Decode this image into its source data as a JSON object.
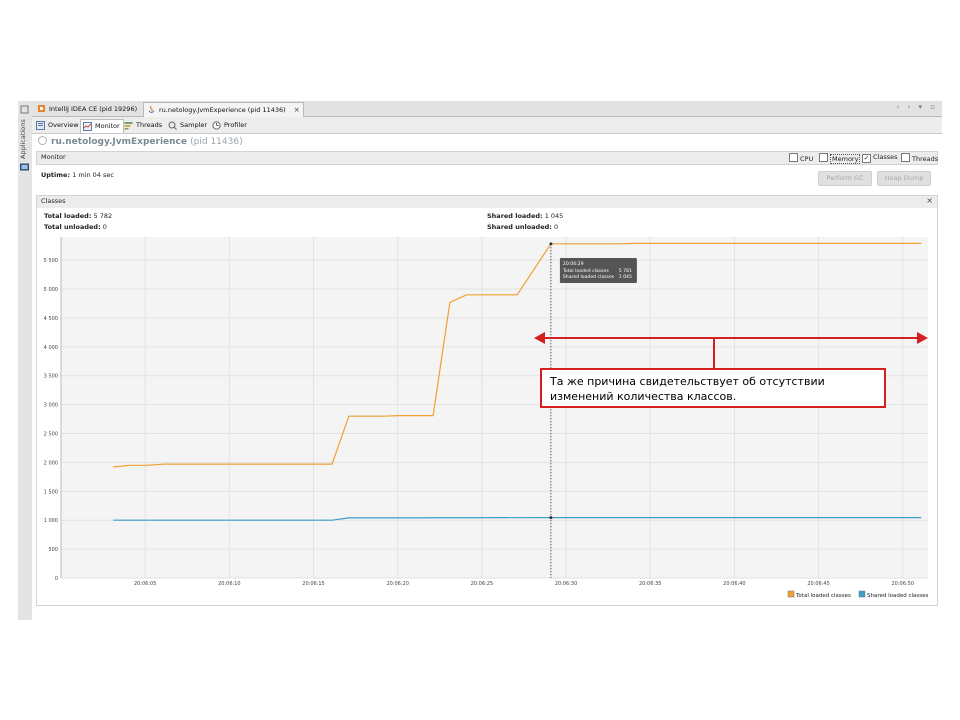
{
  "left_strip": {
    "label": "Applications",
    "icons": [
      "pin-icon",
      "monitor-icon"
    ]
  },
  "tabs": [
    {
      "label": "IntelliJ IDEA CE (pid 19296)",
      "icon": "intellij-app-icon",
      "active": false
    },
    {
      "label": "ru.netology.JvmExperience (pid 11436)",
      "icon": "java-app-icon",
      "active": true
    }
  ],
  "tab_close_glyph": "×",
  "window_controls": "‹ › ▾ ▫",
  "subtabs": [
    {
      "label": "Overview",
      "icon": "overview-icon"
    },
    {
      "label": "Monitor",
      "icon": "monitor-icon",
      "active": true
    },
    {
      "label": "Threads",
      "icon": "threads-icon"
    },
    {
      "label": "Sampler",
      "icon": "sampler-icon"
    },
    {
      "label": "Profiler",
      "icon": "profiler-icon"
    }
  ],
  "app_title": {
    "name": "ru.netology.JvmExperience",
    "pid": "(pid 11436)"
  },
  "monitor": {
    "title": "Monitor",
    "checkboxes": [
      {
        "label": "CPU",
        "checked": false
      },
      {
        "label": "Memory",
        "checked": false
      },
      {
        "label": "Classes",
        "checked": true
      },
      {
        "label": "Threads",
        "checked": false
      }
    ],
    "uptime_label": "Uptime:",
    "uptime_value": "1 min 04 sec",
    "perform_gc": "Perform GC",
    "heap_dump": "Heap Dump"
  },
  "classes_panel": {
    "title": "Classes",
    "close_glyph": "×",
    "total_loaded_label": "Total loaded:",
    "total_loaded_value": "5 782",
    "total_unloaded_label": "Total unloaded:",
    "total_unloaded_value": "0",
    "shared_loaded_label": "Shared loaded:",
    "shared_loaded_value": "1 045",
    "shared_unloaded_label": "Shared unloaded:",
    "shared_unloaded_value": "0"
  },
  "chart_data": {
    "type": "line",
    "y_ticks": [
      "0",
      "500",
      "1 000",
      "1 500",
      "2 000",
      "2 500",
      "3 000",
      "3 500",
      "4 000",
      "4 500",
      "5 000",
      "5 500"
    ],
    "x_ticks": [
      "20:06:05",
      "20:06:10",
      "20:06:15",
      "20:06:20",
      "20:06:25",
      "20:06:30",
      "20:06:35",
      "20:06:40",
      "20:06:45",
      "20:06:50"
    ],
    "ylim": [
      0,
      5900
    ],
    "series": [
      {
        "name": "Total loaded classes",
        "color": "#f0a030",
        "points": [
          [
            3.1,
            1920
          ],
          [
            4.1,
            1950
          ],
          [
            5.1,
            1950
          ],
          [
            6.1,
            1970
          ],
          [
            10.1,
            1970
          ],
          [
            16.1,
            1970
          ],
          [
            17.1,
            2800
          ],
          [
            19.1,
            2800
          ],
          [
            20.1,
            2810
          ],
          [
            22.1,
            2810
          ],
          [
            23.1,
            4770
          ],
          [
            24.1,
            4900
          ],
          [
            27.1,
            4900
          ],
          [
            29.1,
            5782
          ],
          [
            33.1,
            5782
          ],
          [
            34.1,
            5790
          ],
          [
            51.1,
            5790
          ]
        ]
      },
      {
        "name": "Shared loaded classes",
        "color": "#3a9fc8",
        "points": [
          [
            3.1,
            1000
          ],
          [
            16.1,
            1000
          ],
          [
            17.1,
            1040
          ],
          [
            29.1,
            1045
          ],
          [
            51.1,
            1045
          ]
        ]
      }
    ],
    "cursor": {
      "time": "20:06:29",
      "x": 29.1
    },
    "tooltip": {
      "time": "20:06:29",
      "rows": [
        [
          "Total loaded classes",
          "5 781"
        ],
        [
          "Shared loaded classes",
          "1 045"
        ]
      ]
    },
    "legend": [
      "Total loaded classes",
      "Shared loaded classes"
    ],
    "legend_placement": "bottom-right"
  },
  "annotation": {
    "text": "Та же причина свидетельствует об отсутствии изменений количества классов.",
    "color": "#d42020"
  }
}
